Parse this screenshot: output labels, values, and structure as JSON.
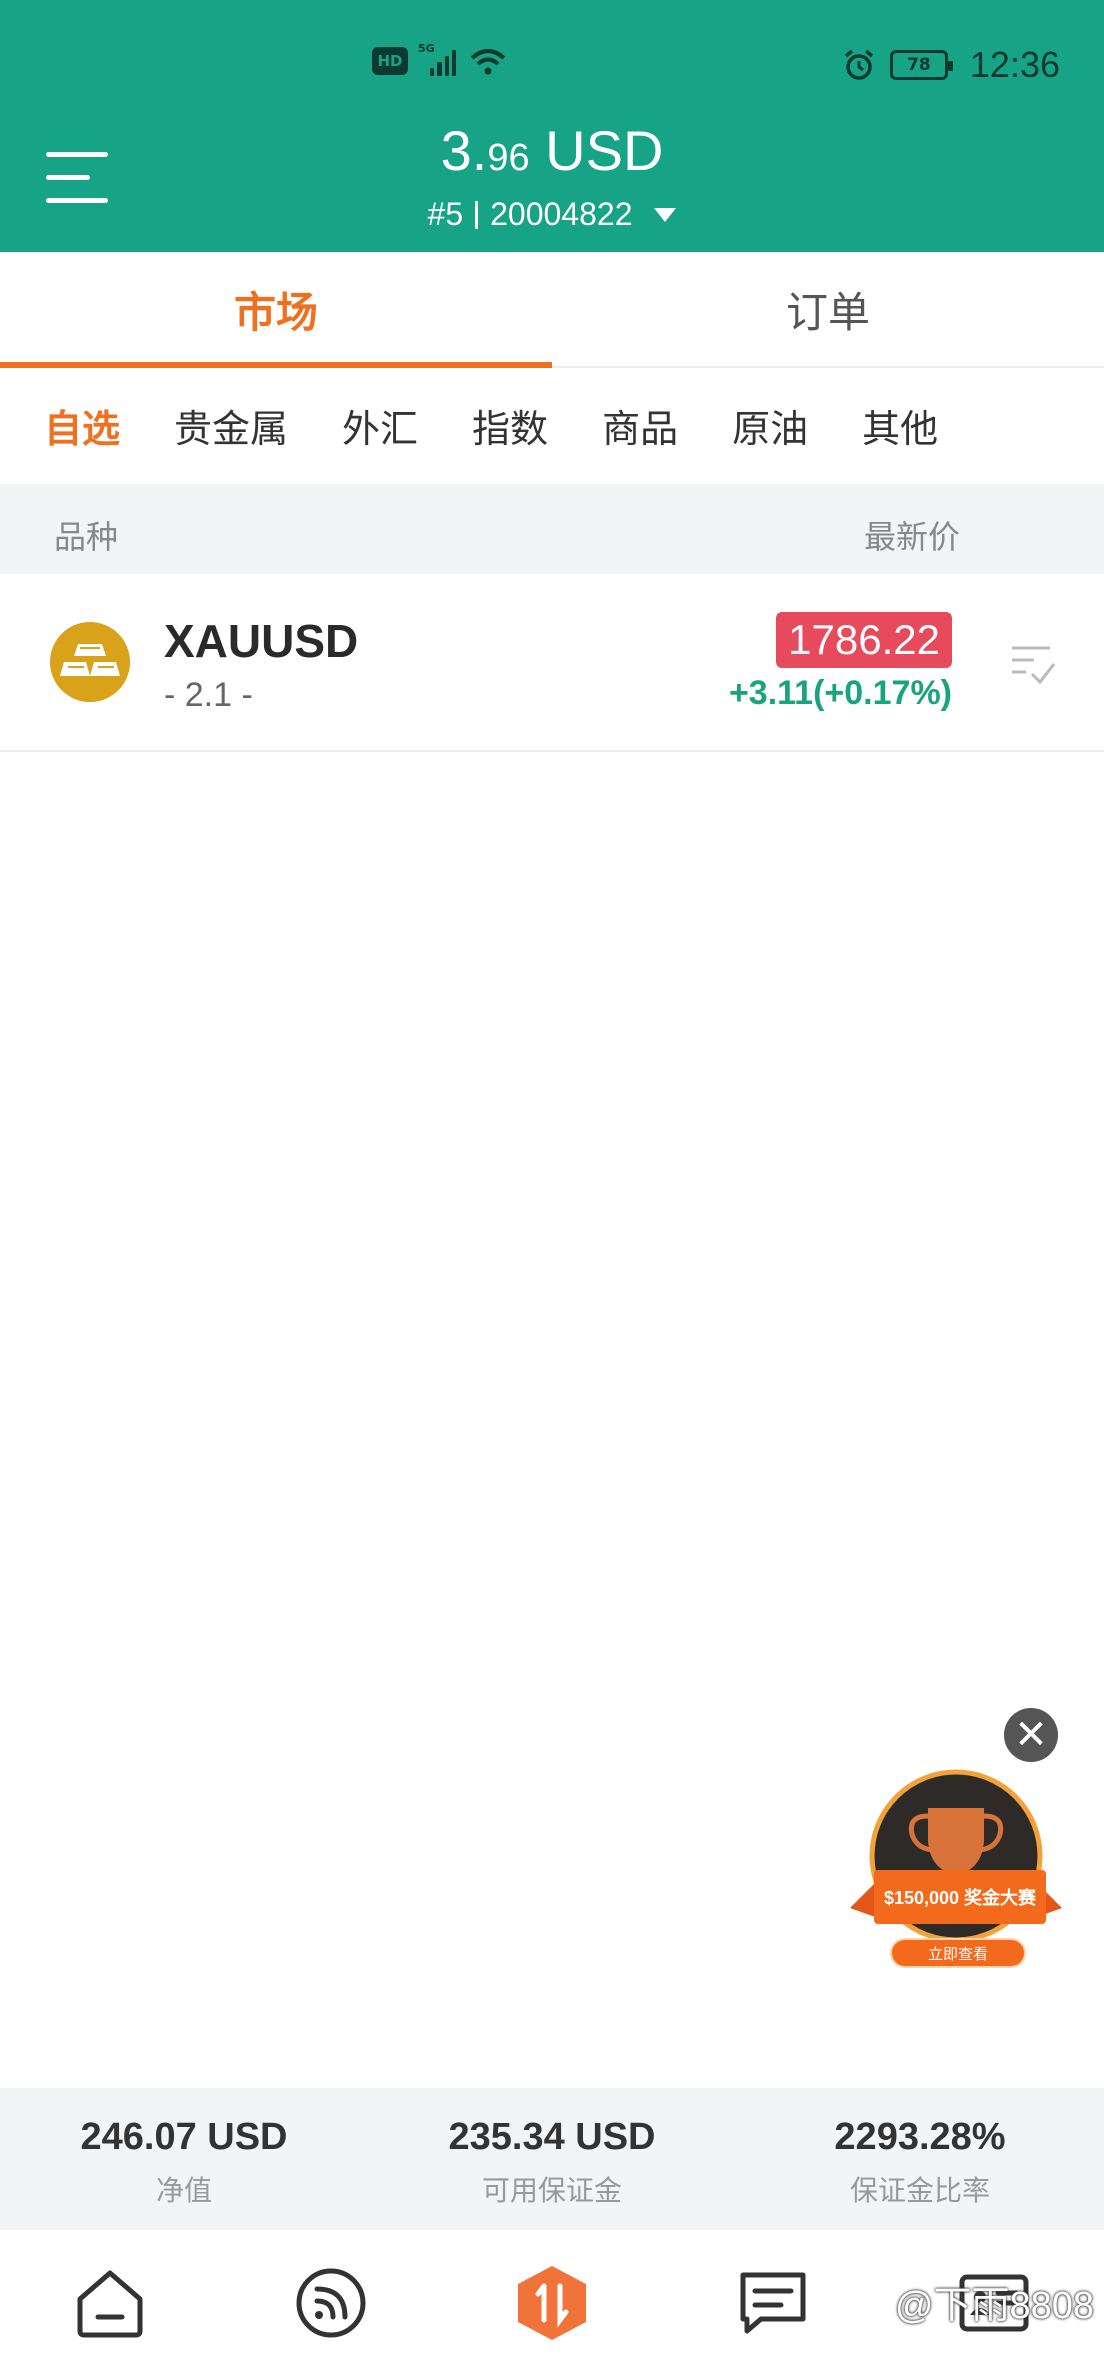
{
  "status_bar": {
    "network_hd": "HD",
    "network_5g": "5G",
    "battery": "78",
    "time": "12:36"
  },
  "header": {
    "balance_int": "3.",
    "balance_dec": "96",
    "balance_currency": "USD",
    "account_rank": "#5",
    "account_id": "20004822"
  },
  "main_tabs": [
    {
      "label": "市场",
      "active": true
    },
    {
      "label": "订单",
      "active": false
    }
  ],
  "category_tabs": [
    "自选",
    "贵金属",
    "外汇",
    "指数",
    "商品",
    "原油",
    "其他"
  ],
  "columns": {
    "left": "品种",
    "right": "最新价"
  },
  "instruments": [
    {
      "symbol": "XAUUSD",
      "spread": "- 2.1 -",
      "price": "1786.22",
      "change": "+3.11(+0.17%)",
      "price_color": "#e64a5b",
      "change_color": "#1aa37f"
    }
  ],
  "promo": {
    "ribbon": "$150,000 奖金大赛",
    "button": "立即查看",
    "close": "✕"
  },
  "summary": [
    {
      "value": "246.07 USD",
      "label": "净值"
    },
    {
      "value": "235.34 USD",
      "label": "可用保证金"
    },
    {
      "value": "2293.28%",
      "label": "保证金比率"
    }
  ],
  "bottom_nav": [
    {
      "name": "home-icon"
    },
    {
      "name": "feed-icon"
    },
    {
      "name": "trade-icon"
    },
    {
      "name": "message-icon"
    },
    {
      "name": "profile-card-icon"
    }
  ],
  "watermark": "@下雨8808",
  "colors": {
    "header_bg": "#16a386",
    "accent": "#f07020",
    "price_bg": "#e64a5b",
    "positive": "#1aa37f"
  }
}
